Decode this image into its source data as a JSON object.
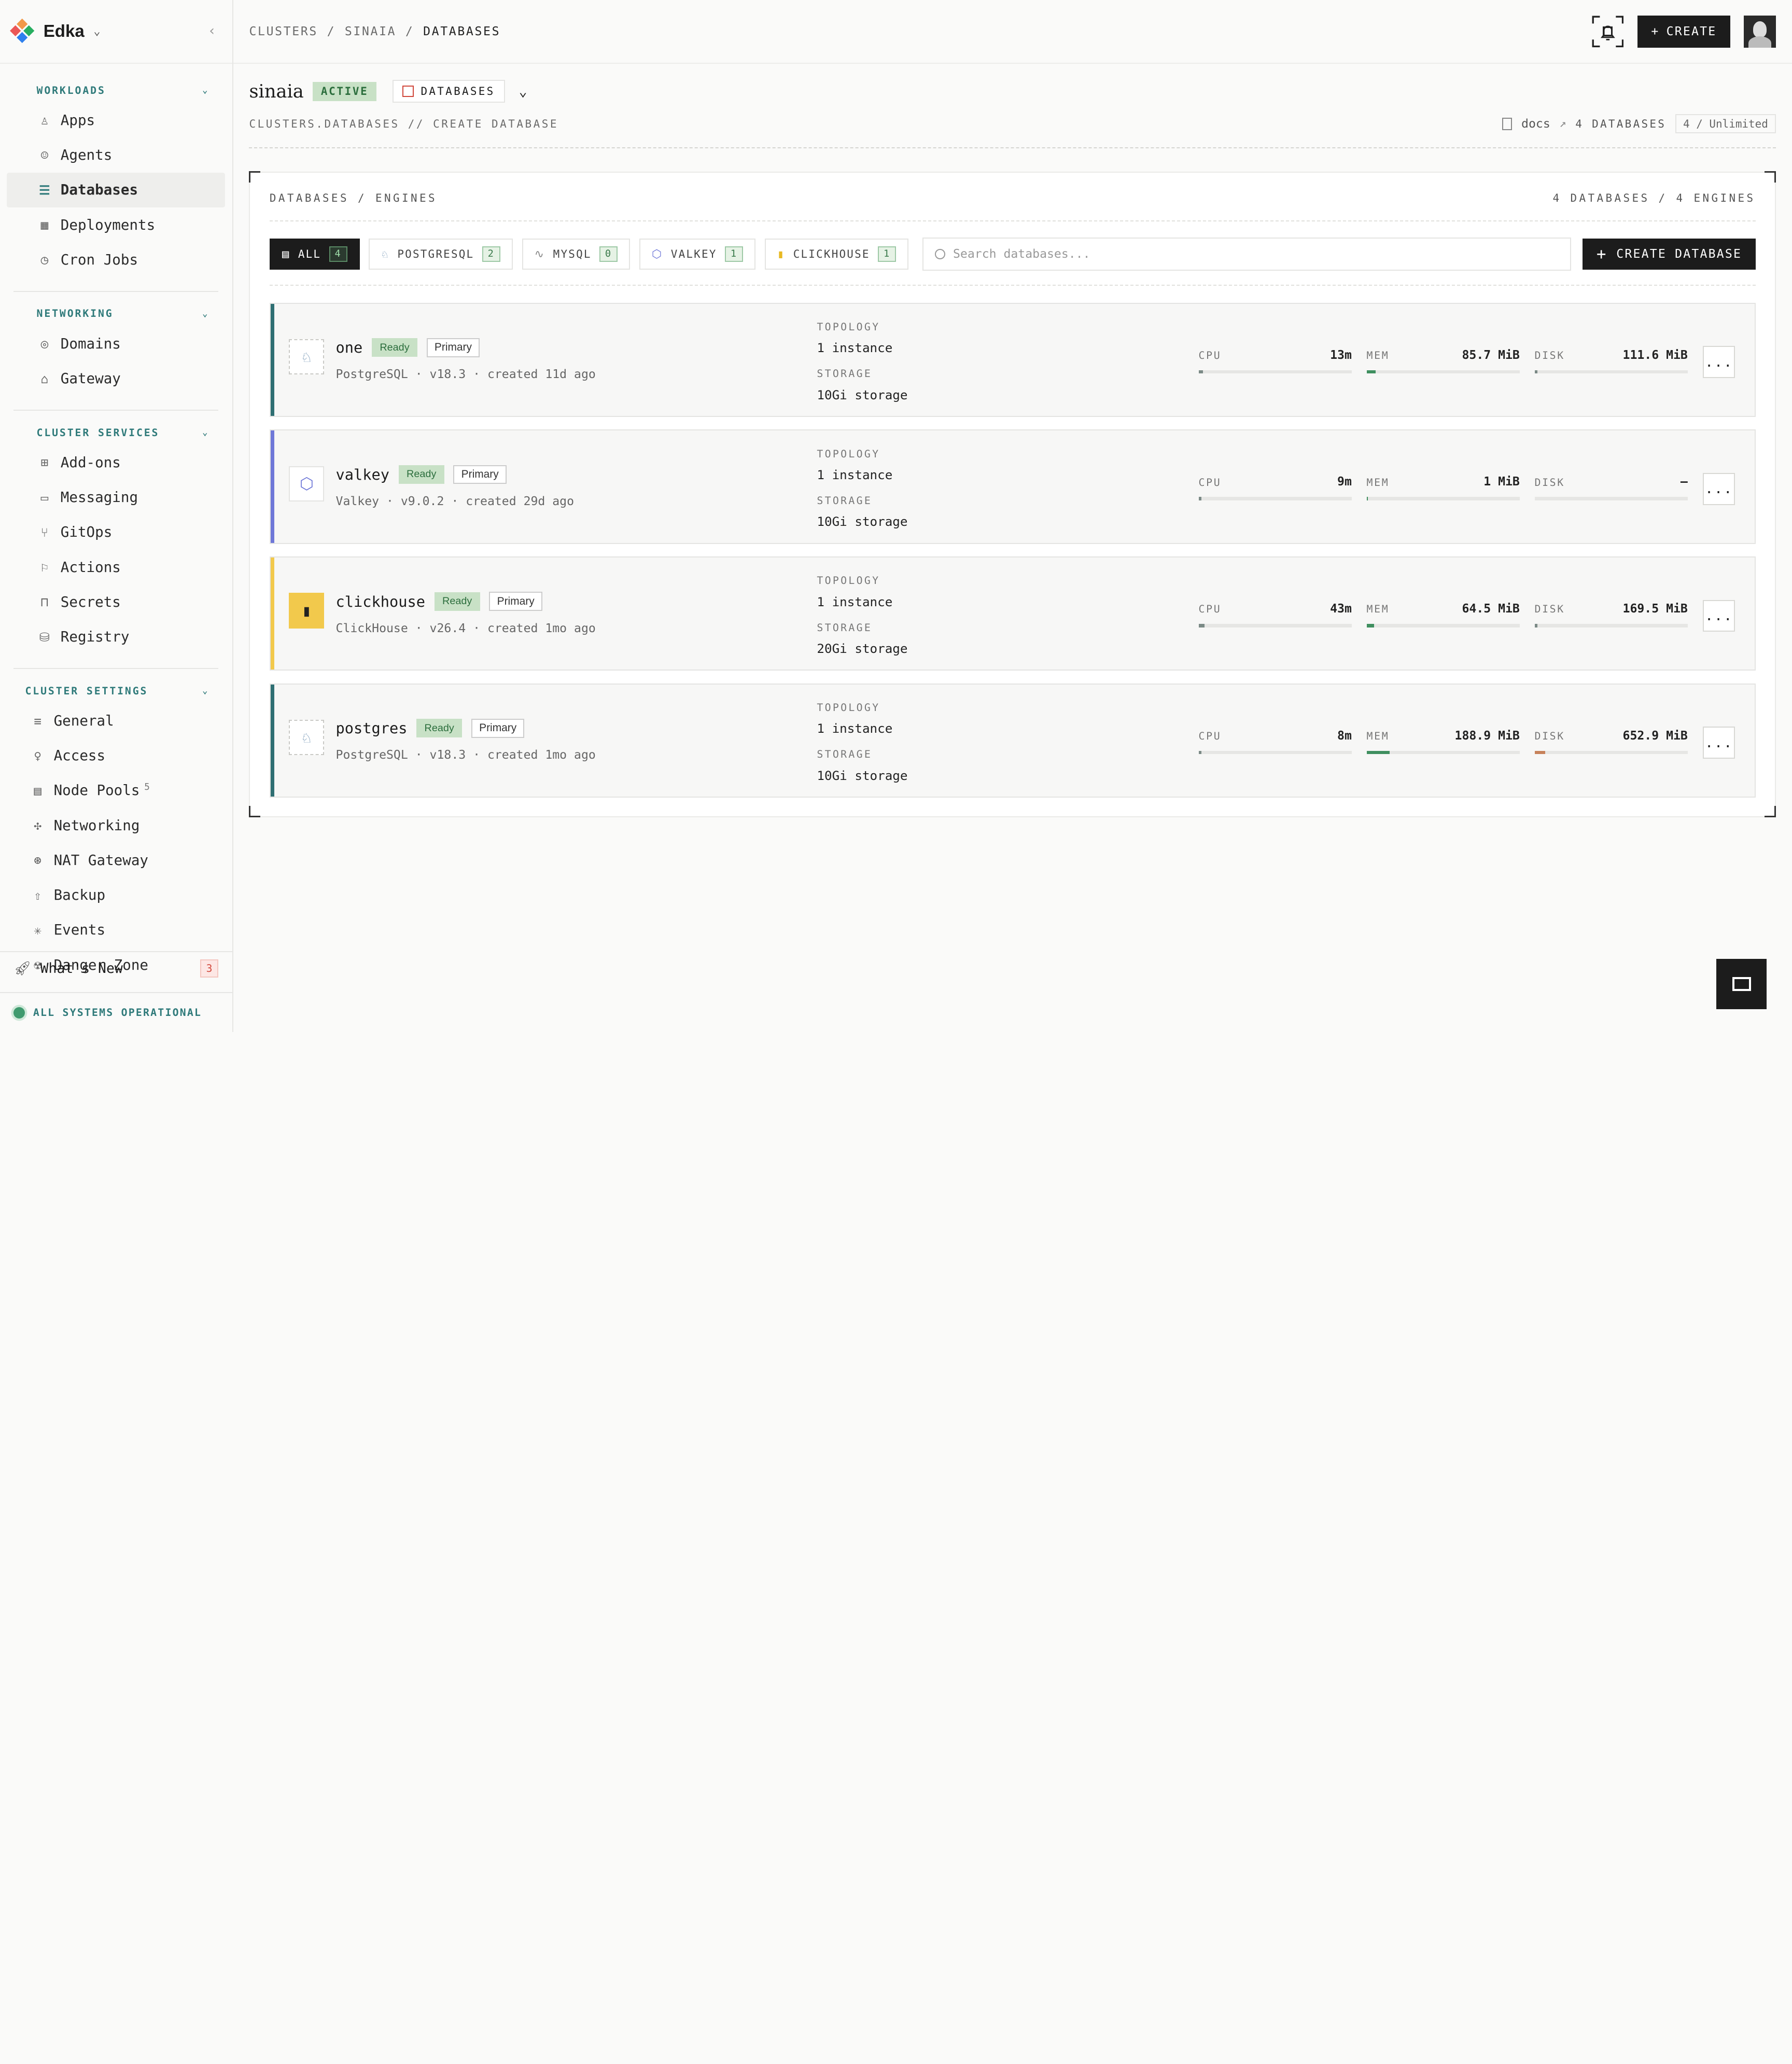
{
  "app": {
    "workspace": "Edka"
  },
  "sidebar": {
    "sections": [
      {
        "title": "WORKLOADS",
        "items": [
          {
            "label": "Apps",
            "icon": "person-icon"
          },
          {
            "label": "Agents",
            "icon": "agent-icon"
          },
          {
            "label": "Databases",
            "icon": "database-icon",
            "active": true
          },
          {
            "label": "Deployments",
            "icon": "deployments-icon"
          },
          {
            "label": "Cron Jobs",
            "icon": "clock-icon"
          }
        ]
      },
      {
        "title": "NETWORKING",
        "items": [
          {
            "label": "Domains",
            "icon": "globe-icon"
          },
          {
            "label": "Gateway",
            "icon": "gateway-icon"
          }
        ]
      },
      {
        "title": "CLUSTER SERVICES",
        "items": [
          {
            "label": "Add-ons",
            "icon": "addons-icon"
          },
          {
            "label": "Messaging",
            "icon": "message-icon"
          },
          {
            "label": "GitOps",
            "icon": "git-icon"
          },
          {
            "label": "Actions",
            "icon": "actions-icon"
          },
          {
            "label": "Secrets",
            "icon": "lock-icon"
          },
          {
            "label": "Registry",
            "icon": "registry-icon"
          }
        ]
      },
      {
        "title": "CLUSTER SETTINGS",
        "items": [
          {
            "label": "General",
            "icon": "sliders-icon"
          },
          {
            "label": "Access",
            "icon": "key-icon"
          },
          {
            "label": "Node Pools",
            "icon": "server-icon",
            "sup": "5"
          },
          {
            "label": "Networking",
            "icon": "network-icon"
          },
          {
            "label": "NAT Gateway",
            "icon": "nat-icon"
          },
          {
            "label": "Backup",
            "icon": "backup-icon"
          },
          {
            "label": "Events",
            "icon": "events-icon"
          },
          {
            "label": "Danger Zone",
            "icon": "radiation-icon"
          }
        ]
      }
    ],
    "whats_new": {
      "label": "What's New",
      "count": "3"
    },
    "status": "ALL SYSTEMS OPERATIONAL"
  },
  "topbar": {
    "breadcrumb": [
      "CLUSTERS",
      "/",
      "SINAIA",
      "/",
      "DATABASES"
    ],
    "create_label": "CREATE"
  },
  "header": {
    "cluster_name": "sinaia",
    "state": "ACTIVE",
    "section_label": "DATABASES",
    "subline": "CLUSTERS.DATABASES // CREATE DATABASE",
    "docs_label": "docs",
    "db_count": "4 DATABASES",
    "limit": "4 / Unlimited"
  },
  "panel": {
    "title": "DATABASES / ENGINES",
    "summary": "4 DATABASES / 4 ENGINES",
    "filters": [
      {
        "label": "ALL",
        "count": "4",
        "active": true,
        "icon": "list-icon"
      },
      {
        "label": "POSTGRESQL",
        "count": "2",
        "icon": "elephant-icon"
      },
      {
        "label": "MYSQL",
        "count": "0",
        "icon": "dolphin-icon"
      },
      {
        "label": "VALKEY",
        "count": "1",
        "icon": "valkey-icon"
      },
      {
        "label": "CLICKHOUSE",
        "count": "1",
        "icon": "clickhouse-icon"
      }
    ],
    "search_placeholder": "Search databases...",
    "create_db_label": "CREATE DATABASE"
  },
  "labels": {
    "topology": "TOPOLOGY",
    "storage": "STORAGE",
    "cpu": "CPU",
    "mem": "MEM",
    "disk": "DISK",
    "more": "..."
  },
  "databases": [
    {
      "name": "one",
      "status": "Ready",
      "role": "Primary",
      "engine": "PostgreSQL",
      "version": "v18.3",
      "created": "created 11d ago",
      "topology": "1 instance",
      "storage": "10Gi storage",
      "cpu": "13m",
      "mem": "85.7 MiB",
      "disk": "111.6 MiB",
      "cpu_pct": 3,
      "mem_pct": 6,
      "disk_pct": 2,
      "accent": "#2f6f73",
      "icon": "elephant-icon"
    },
    {
      "name": "valkey",
      "status": "Ready",
      "role": "Primary",
      "engine": "Valkey",
      "version": "v9.0.2",
      "created": "created 29d ago",
      "topology": "1 instance",
      "storage": "10Gi storage",
      "cpu": "9m",
      "mem": "1 MiB",
      "disk": "–",
      "cpu_pct": 2,
      "mem_pct": 1,
      "disk_pct": 0,
      "accent": "#6f78d8",
      "icon": "valkey-icon"
    },
    {
      "name": "clickhouse",
      "status": "Ready",
      "role": "Primary",
      "engine": "ClickHouse",
      "version": "v26.4",
      "created": "created 1mo ago",
      "topology": "1 instance",
      "storage": "20Gi storage",
      "cpu": "43m",
      "mem": "64.5 MiB",
      "disk": "169.5 MiB",
      "cpu_pct": 4,
      "mem_pct": 5,
      "disk_pct": 2,
      "accent": "#f2c94c",
      "icon": "clickhouse-icon"
    },
    {
      "name": "postgres",
      "status": "Ready",
      "role": "Primary",
      "engine": "PostgreSQL",
      "version": "v18.3",
      "created": "created 1mo ago",
      "topology": "1 instance",
      "storage": "10Gi storage",
      "cpu": "8m",
      "mem": "188.9 MiB",
      "disk": "652.9 MiB",
      "cpu_pct": 2,
      "mem_pct": 15,
      "disk_pct": 7,
      "accent": "#2f6f73",
      "icon": "elephant-icon"
    }
  ],
  "colors": {
    "teal": "#2f7a7a",
    "green_fill": "#3f8f5f",
    "orange_fill": "#c7825a",
    "dark": "#1c1c1c"
  }
}
